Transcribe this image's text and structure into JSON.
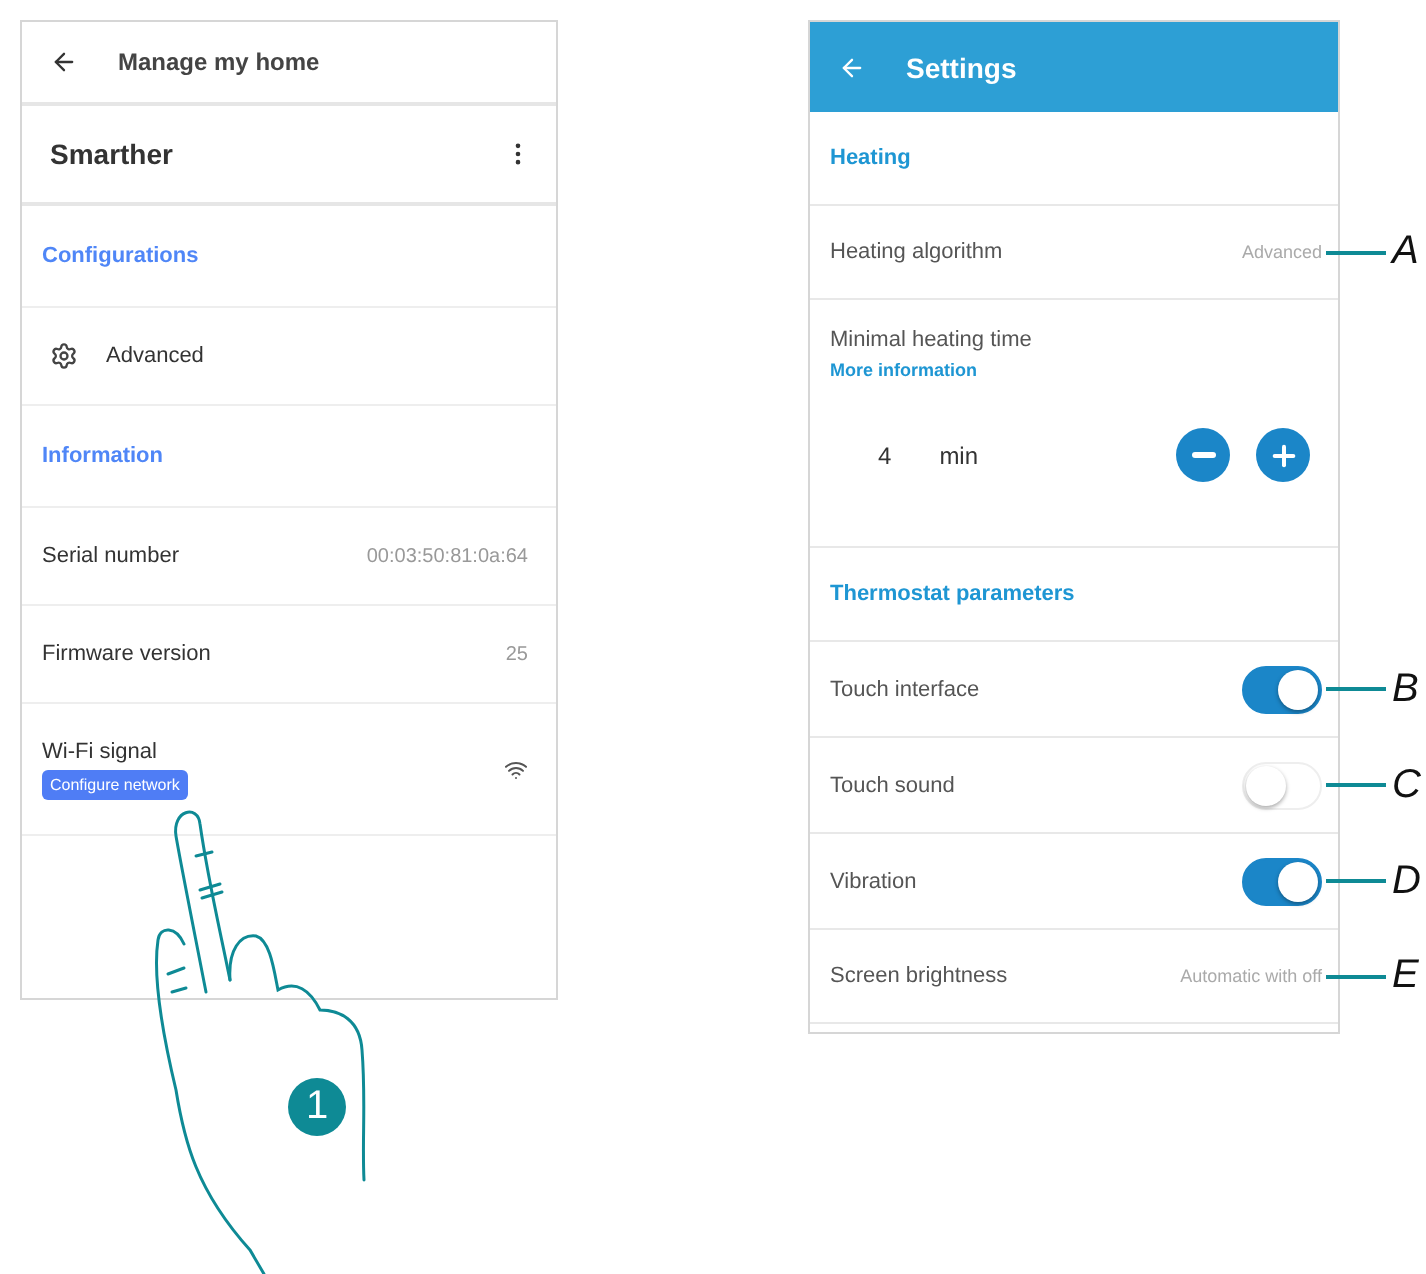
{
  "left_screen": {
    "title": "Manage my home",
    "device_name": "Smarther",
    "sections": [
      {
        "heading": "Configurations",
        "rows": [
          {
            "kind": "nav",
            "label": "Advanced"
          }
        ]
      },
      {
        "heading": "Information",
        "rows": [
          {
            "kind": "info",
            "label": "Serial number",
            "value": "00:03:50:81:0a:64"
          },
          {
            "kind": "info",
            "label": "Firmware version",
            "value": "25"
          },
          {
            "kind": "wifi",
            "label": "Wi-Fi signal",
            "button": "Configure network"
          }
        ]
      }
    ]
  },
  "right_screen": {
    "title": "Settings",
    "sections": [
      {
        "heading": "Heating",
        "rows": [
          {
            "kind": "value",
            "label": "Heating algorithm",
            "value": "Advanced",
            "callout": "A"
          },
          {
            "kind": "stepper",
            "label": "Minimal heating time",
            "link": "More information",
            "value": "4",
            "unit": "min"
          }
        ]
      },
      {
        "heading": "Thermostat parameters",
        "rows": [
          {
            "kind": "toggle",
            "label": "Touch interface",
            "on": true,
            "callout": "B"
          },
          {
            "kind": "toggle",
            "label": "Touch sound",
            "on": false,
            "callout": "C"
          },
          {
            "kind": "toggle",
            "label": "Vibration",
            "on": true,
            "callout": "D"
          },
          {
            "kind": "value",
            "label": "Screen brightness",
            "value": "Automatic with off",
            "callout": "E"
          }
        ]
      }
    ]
  },
  "step_badge": "1"
}
